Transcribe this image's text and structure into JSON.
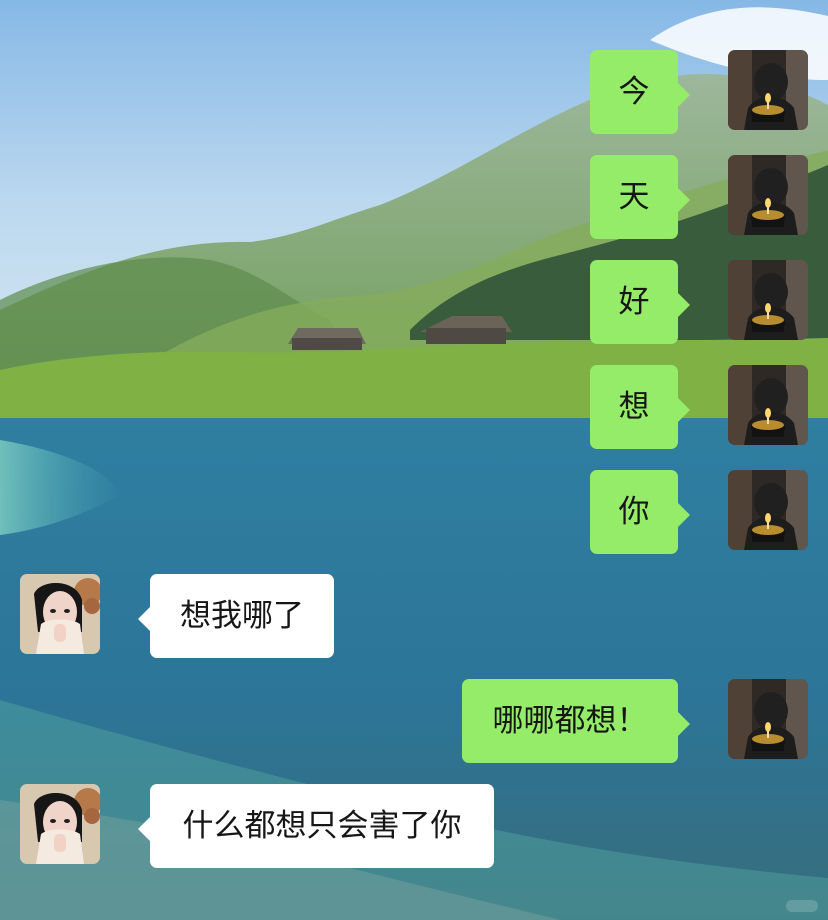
{
  "chat": {
    "messages": [
      {
        "side": "right",
        "text": "今",
        "avatar": "male-birthday-avatar"
      },
      {
        "side": "right",
        "text": "天",
        "avatar": "male-birthday-avatar"
      },
      {
        "side": "right",
        "text": "好",
        "avatar": "male-birthday-avatar"
      },
      {
        "side": "right",
        "text": "想",
        "avatar": "male-birthday-avatar"
      },
      {
        "side": "right",
        "text": "你",
        "avatar": "male-birthday-avatar"
      },
      {
        "side": "left",
        "text": "想我哪了",
        "avatar": "female-portrait-avatar"
      },
      {
        "side": "right",
        "text": "哪哪都想！",
        "avatar": "male-birthday-avatar"
      },
      {
        "side": "left",
        "text": "什么都想只会害了你",
        "avatar": "female-portrait-avatar"
      }
    ]
  },
  "colors": {
    "outgoing_bubble": "#95ec69",
    "incoming_bubble": "#ffffff",
    "text": "#161616",
    "sky": "#8fc0ea",
    "grass": "#75a83c",
    "lake": "#2f7c9f"
  },
  "icons": {
    "male_avatar": "birthday-cake-avatar-icon",
    "female_avatar": "female-portrait-icon"
  }
}
